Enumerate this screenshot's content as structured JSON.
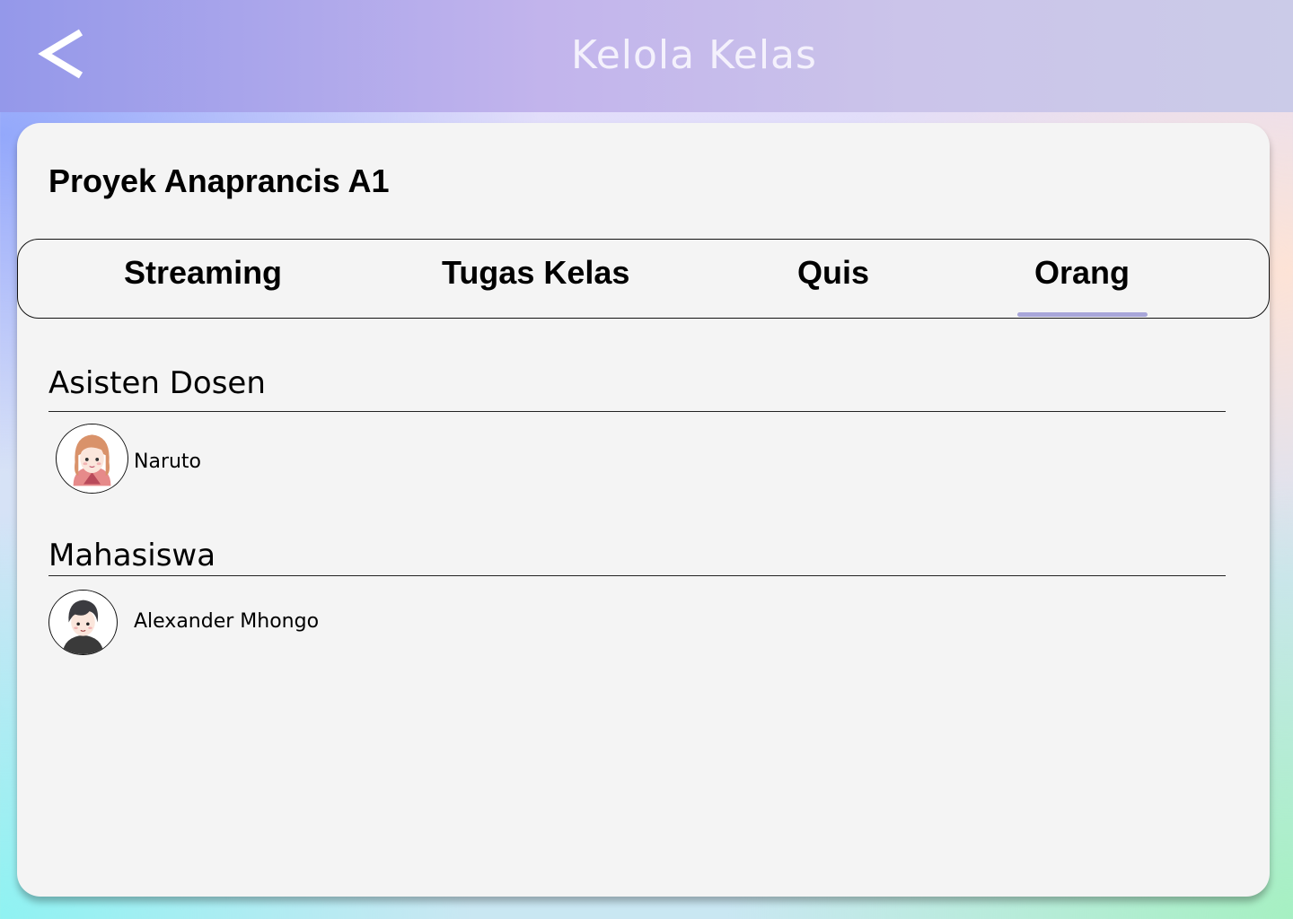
{
  "header": {
    "title": "Kelola Kelas",
    "back_icon": "chevron-left-icon"
  },
  "class": {
    "name": "Proyek Anaprancis A1"
  },
  "tabs": [
    {
      "label": "Streaming",
      "active": false
    },
    {
      "label": "Tugas Kelas",
      "active": false
    },
    {
      "label": "Quis",
      "active": false
    },
    {
      "label": "Orang",
      "active": true
    }
  ],
  "sections": {
    "assistants": {
      "heading": "Asisten Dosen",
      "people": [
        {
          "name": "Naruto",
          "avatar": "female-avatar"
        }
      ]
    },
    "students": {
      "heading": "Mahasiswa",
      "people": [
        {
          "name": "Alexander Mhongo",
          "avatar": "male-avatar"
        }
      ]
    }
  },
  "colors": {
    "tab_active_indicator": "#a8a6d9",
    "card_background": "#f4f4f4"
  }
}
